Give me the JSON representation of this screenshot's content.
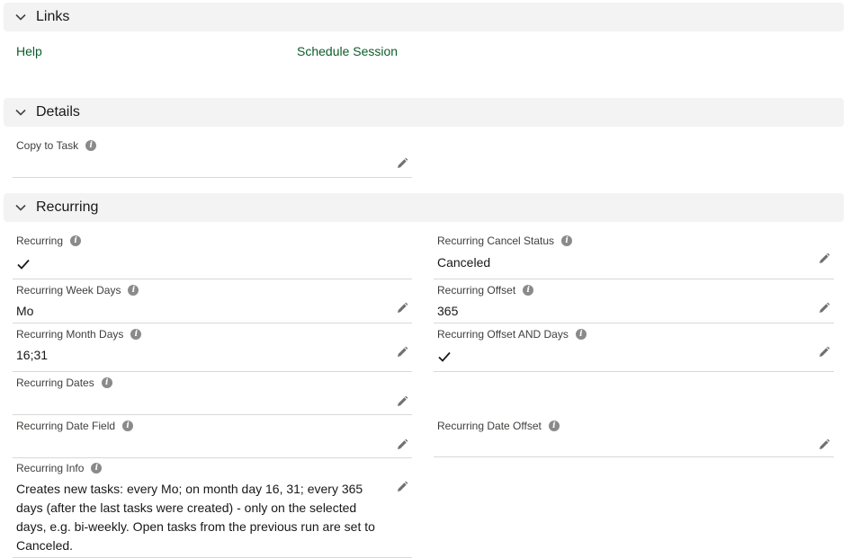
{
  "sections": {
    "links": {
      "title": "Links"
    },
    "details": {
      "title": "Details"
    },
    "recurring": {
      "title": "Recurring"
    }
  },
  "links": {
    "help": "Help",
    "schedule": "Schedule Session"
  },
  "details": {
    "copy_to_task": {
      "label": "Copy to Task",
      "value": ""
    }
  },
  "recurring": {
    "recurring": {
      "label": "Recurring",
      "checked": true
    },
    "cancel_status": {
      "label": "Recurring Cancel Status",
      "value": "Canceled"
    },
    "week_days": {
      "label": "Recurring Week Days",
      "value": "Mo"
    },
    "offset": {
      "label": "Recurring Offset",
      "value": "365"
    },
    "month_days": {
      "label": "Recurring Month Days",
      "value": "16;31"
    },
    "offset_and_days": {
      "label": "Recurring Offset AND Days",
      "checked": true
    },
    "dates": {
      "label": "Recurring Dates",
      "value": ""
    },
    "date_field": {
      "label": "Recurring Date Field",
      "value": ""
    },
    "date_offset": {
      "label": "Recurring Date Offset",
      "value": ""
    },
    "info": {
      "label": "Recurring Info",
      "value": "Creates new tasks: every Mo; on month day 16, 31; every 365 days (after the last tasks were created) - only on the selected days, e.g. bi-weekly. Open tasks from the previous run are set to Canceled."
    }
  },
  "icons": {
    "chevron": "chevron-down-icon",
    "info": "info-icon",
    "edit": "pencil-icon",
    "check": "check-icon"
  },
  "colors": {
    "link": "#0b5d2a",
    "header_bg": "#f3f3f3"
  }
}
